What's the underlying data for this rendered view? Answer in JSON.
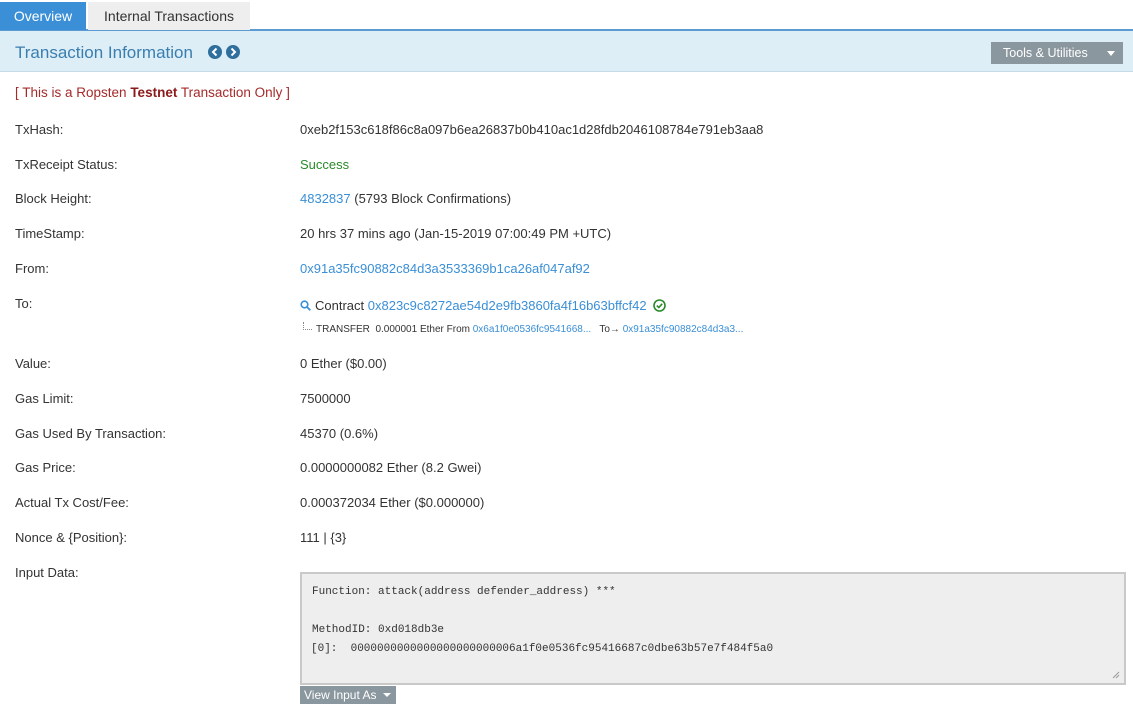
{
  "tabs": {
    "overview": "Overview",
    "internal": "Internal Transactions"
  },
  "header": {
    "title": "Transaction Information",
    "prev_icon": "chevron-left-circle-icon",
    "next_icon": "chevron-right-circle-icon",
    "tools_label": "Tools & Utilities"
  },
  "notice": {
    "prefix": "[ This is a Ropsten ",
    "bold": "Testnet",
    "suffix": " Transaction Only ]"
  },
  "details": {
    "txhash": {
      "label": "TxHash:",
      "value": "0xeb2f153c618f86c8a097b6ea26837b0b410ac1d28fdb2046108784e791eb3aa8"
    },
    "status": {
      "label": "TxReceipt Status:",
      "value": "Success"
    },
    "block": {
      "label": "Block Height:",
      "value": "4832837",
      "confirmations": " (5793 Block Confirmations)"
    },
    "timestamp": {
      "label": "TimeStamp:",
      "value": "20 hrs 37 mins ago (Jan-15-2019 07:00:49 PM +UTC)"
    },
    "from": {
      "label": "From:",
      "value": "0x91a35fc90882c84d3a3533369b1ca26af047af92"
    },
    "to": {
      "label": "To:",
      "prefix": "Contract ",
      "address": "0x823c9c8272ae54d2e9fb3860fa4f16b63bffcf42",
      "transfer": {
        "type": "TRANSFER",
        "amount": "0.000001 Ether From",
        "from_addr": "0x6a1f0e0536fc9541668...",
        "to_label": "To",
        "to_addr": "0x91a35fc90882c84d3a3..."
      }
    },
    "value": {
      "label": "Value:",
      "value": "0 Ether ($0.00)"
    },
    "gas_limit": {
      "label": "Gas Limit:",
      "value": "7500000"
    },
    "gas_used": {
      "label": "Gas Used By Transaction:",
      "value": "45370 (0.6%)"
    },
    "gas_price": {
      "label": "Gas Price:",
      "value": "0.0000000082 Ether (8.2 Gwei)"
    },
    "fee": {
      "label": "Actual Tx Cost/Fee:",
      "value": "0.000372034 Ether ($0.000000)"
    },
    "nonce": {
      "label": "Nonce & {Position}:",
      "value": "111 | {3}"
    },
    "input": {
      "label": "Input Data:",
      "function": "Function: attack(address defender_address) ***",
      "method_id": "MethodID: 0xd018db3e",
      "param0": "[0]:  0000000000000000000000006a1f0e0536fc95416687c0dbe63b57e7f484f5a0",
      "view_as": "View Input As"
    }
  },
  "colors": {
    "accent": "#3a8fd6",
    "header_bg": "#ddeef7",
    "success": "#2a8a2a",
    "testnet": "#a52a2a"
  }
}
